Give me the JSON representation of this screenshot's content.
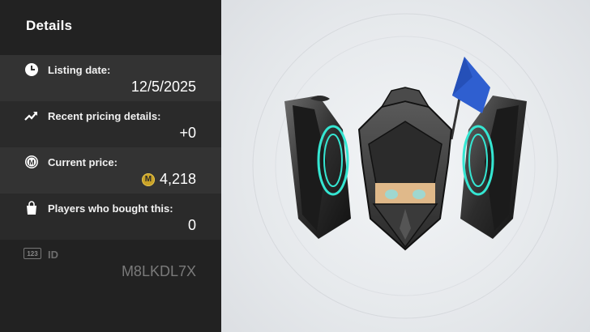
{
  "panel": {
    "title": "Details",
    "listing": {
      "label": "Listing date:",
      "value": "12/5/2025",
      "icon": "clock-icon"
    },
    "pricing": {
      "label": "Recent pricing details:",
      "value": "+0",
      "icon": "trend-up-icon"
    },
    "price": {
      "label": "Current price:",
      "value": "4,218",
      "icon": "coin-m-icon",
      "coin_letter": "M"
    },
    "players": {
      "label": "Players who bought this:",
      "value": "0",
      "icon": "shopping-bag-icon"
    },
    "id": {
      "label": "ID",
      "value": "M8LKDL7X",
      "icon": "number-123-icon",
      "badge": "123"
    }
  },
  "item": {
    "name_icon": "knight-helmet-with-glowing-wings"
  },
  "colors": {
    "panel_bg": "#222222",
    "row_alt": "#333333",
    "accent_cyan": "#35e6d2",
    "coin_gold": "#c9a227"
  }
}
